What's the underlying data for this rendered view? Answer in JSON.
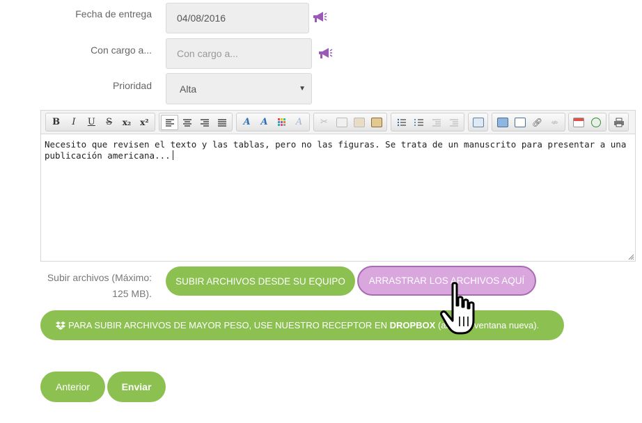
{
  "form": {
    "delivery_label": "Fecha de entrega",
    "delivery_value": "04/08/2016",
    "charge_label": "Con cargo a...",
    "charge_placeholder": "Con cargo a...",
    "priority_label": "Prioridad",
    "priority_value": "Alta"
  },
  "toolbar": {
    "bold": "B",
    "italic": "I",
    "underline": "U",
    "strike": "S",
    "subscript": "x₂",
    "superscript": "x²",
    "icons": [
      "bold-icon",
      "italic-icon",
      "underline-icon",
      "strikethrough-icon",
      "subscript-icon",
      "superscript-icon",
      "align-left-icon",
      "align-center-icon",
      "align-right-icon",
      "justify-icon",
      "text-color-icon",
      "background-color-icon",
      "color-palette-icon",
      "clear-format-icon",
      "cut-icon",
      "copy-icon",
      "paste-icon",
      "paste-text-icon",
      "bullet-list-icon",
      "numbered-list-icon",
      "outdent-icon",
      "indent-icon",
      "table-icon",
      "image-icon",
      "email-icon",
      "link-icon",
      "unlink-icon",
      "calendar-icon",
      "clock-icon",
      "print-icon"
    ]
  },
  "editor": {
    "text": "Necesito que revisen el texto y las tablas, pero no las figuras. Se trata de un manuscrito para presentar a una publicación americana..."
  },
  "upload": {
    "label_line1": "Subir archivos (Máximo:",
    "label_line2": "125 MB).",
    "upload_button": "SUBIR ARCHIVOS DESDE SU EQUIPO",
    "drag_button": "ARRASTRAR LOS ARCHIVOS AQUÍ"
  },
  "dropbox": {
    "text_before": "PARA SUBIR ARCHIVOS DE MAYOR PESO, USE NUESTRO RECEPTOR EN ",
    "brand": "DROPBOX",
    "text_after": " (abre en ventana nueva)."
  },
  "nav": {
    "previous": "Anterior",
    "send": "Enviar"
  },
  "colors": {
    "green": "#8cc152",
    "purple": "#d9a6de",
    "icon_purple": "#9b59b6"
  }
}
